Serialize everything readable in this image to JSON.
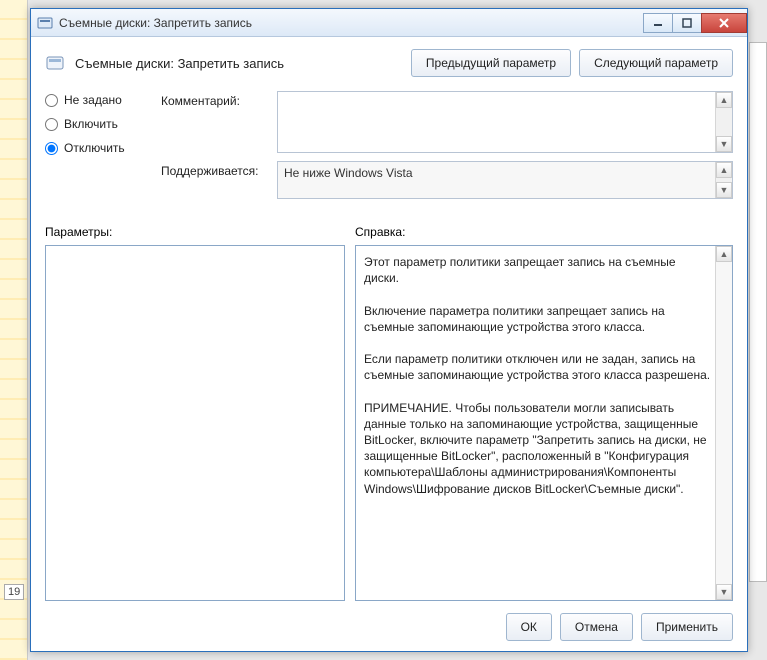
{
  "window": {
    "title": "Съемные диски: Запретить запись"
  },
  "header": {
    "policy_title": "Съемные диски: Запретить запись",
    "prev_btn": "Предыдущий параметр",
    "next_btn": "Следующий параметр"
  },
  "radios": {
    "not_configured": "Не задано",
    "enabled": "Включить",
    "disabled": "Отключить",
    "selected": "disabled"
  },
  "fields": {
    "comment_label": "Комментарий:",
    "comment_value": "",
    "supported_label": "Поддерживается:",
    "supported_value": "Не ниже Windows Vista"
  },
  "sections": {
    "options_label": "Параметры:",
    "help_label": "Справка:"
  },
  "help_text": "Этот параметр политики запрещает запись на съемные диски.\n\nВключение параметра политики запрещает запись на съемные запоминающие устройства этого класса.\n\nЕсли параметр политики отключен или не задан, запись на съемные запоминающие устройства этого класса разрешена.\n\nПРИМЕЧАНИЕ. Чтобы пользователи могли записывать данные только на запоминающие устройства, защищенные BitLocker, включите параметр \"Запретить запись на диски, не защищенные BitLocker\", расположенный в \"Конфигурация компьютера\\Шаблоны администрирования\\Компоненты Windows\\Шифрование дисков BitLocker\\Съемные диски\".",
  "footer": {
    "ok": "ОК",
    "cancel": "Отмена",
    "apply": "Применить"
  },
  "bg": {
    "page_num": "19"
  }
}
